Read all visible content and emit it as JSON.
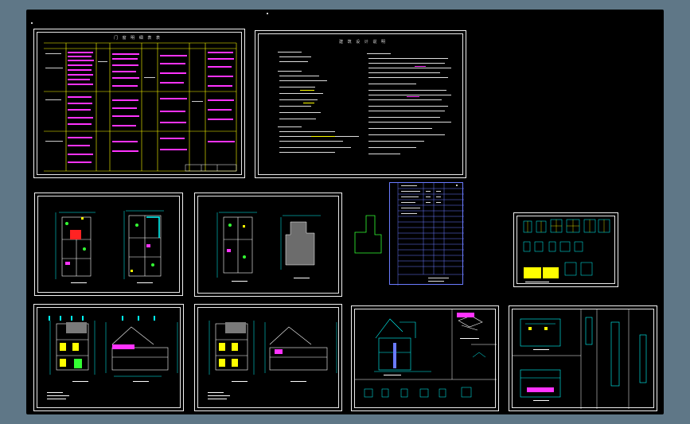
{
  "viewport": {
    "background": "#5f7787",
    "canvas_color": "#000000"
  },
  "sheets": [
    {
      "id": "door-window-schedule",
      "title": "门 窗 明 细 表 表"
    },
    {
      "id": "design-notes",
      "title": "建 筑 设 计 说 明"
    },
    {
      "id": "floor-plans-1"
    },
    {
      "id": "floor-plans-2"
    },
    {
      "id": "site-outline"
    },
    {
      "id": "drawing-index"
    },
    {
      "id": "window-details"
    },
    {
      "id": "elevation-1"
    },
    {
      "id": "elevation-2"
    },
    {
      "id": "section-stair"
    },
    {
      "id": "detail-sections"
    }
  ],
  "colors": {
    "line": "#f2f2f2",
    "cyan": "#00ffff",
    "yellow": "#ffff00",
    "magenta": "#ff33ff",
    "green": "#33ff33",
    "red": "#ff2222",
    "blue": "#6a7bff"
  }
}
